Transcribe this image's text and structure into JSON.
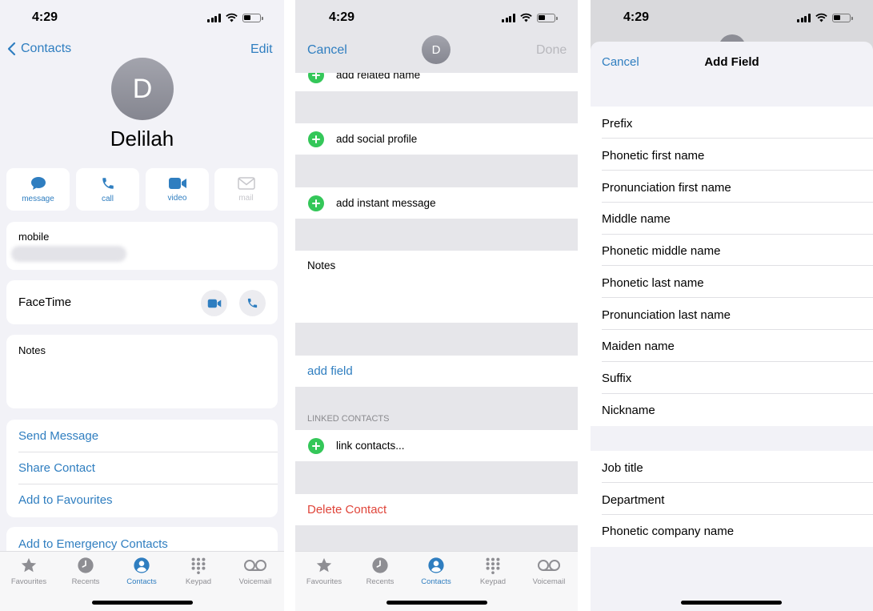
{
  "status": {
    "time": "4:29"
  },
  "screen1": {
    "nav": {
      "back_label": "Contacts",
      "edit_label": "Edit"
    },
    "avatar_initial": "D",
    "name": "Delilah",
    "actions": [
      {
        "label": "message",
        "icon": "message-icon"
      },
      {
        "label": "call",
        "icon": "phone-icon"
      },
      {
        "label": "video",
        "icon": "video-icon"
      },
      {
        "label": "mail",
        "icon": "mail-icon"
      }
    ],
    "mobile_label": "mobile",
    "facetime_label": "FaceTime",
    "notes_label": "Notes",
    "links": {
      "send_message": "Send Message",
      "share_contact": "Share Contact",
      "add_to_favourites": "Add to Favourites",
      "add_emergency": "Add to Emergency Contacts"
    }
  },
  "tabbar": {
    "tabs": [
      {
        "label": "Favourites",
        "icon": "star-icon"
      },
      {
        "label": "Recents",
        "icon": "clock-icon"
      },
      {
        "label": "Contacts",
        "icon": "person-icon",
        "active": true
      },
      {
        "label": "Keypad",
        "icon": "keypad-icon"
      },
      {
        "label": "Voicemail",
        "icon": "voicemail-icon"
      }
    ]
  },
  "screen2": {
    "nav": {
      "cancel_label": "Cancel",
      "done_label": "Done"
    },
    "avatar_initial": "D",
    "add_related_name": "add related name",
    "add_social_profile": "add social profile",
    "add_instant_message": "add instant message",
    "notes_label": "Notes",
    "add_field": "add field",
    "linked_contacts_header": "LINKED CONTACTS",
    "link_contacts": "link contacts...",
    "delete_contact": "Delete Contact"
  },
  "screen3": {
    "nav": {
      "cancel_label": "Cancel",
      "title": "Add Field"
    },
    "group1": [
      "Prefix",
      "Phonetic first name",
      "Pronunciation first name",
      "Middle name",
      "Phonetic middle name",
      "Phonetic last name",
      "Pronunciation last name",
      "Maiden name",
      "Suffix",
      "Nickname"
    ],
    "group2": [
      "Job title",
      "Department",
      "Phonetic company name"
    ]
  },
  "colors": {
    "accent": "#2f7ec0",
    "destructive": "#e0453a",
    "add": "#34c759"
  }
}
